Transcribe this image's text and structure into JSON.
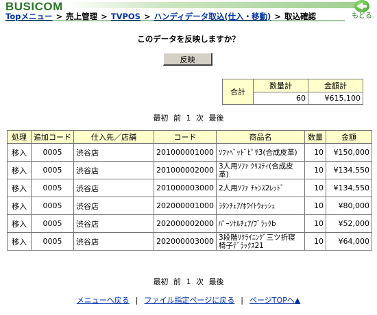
{
  "app": {
    "logo": "BUSICOM",
    "back_label": "もどる"
  },
  "breadcrumb": {
    "items": [
      "Topメニュー",
      "売上管理",
      "TVPOS",
      "ハンディデータ取込(仕入・移動)"
    ],
    "separator": ">",
    "current": "取込確認"
  },
  "question": "このデータを反映しますか？",
  "reflect_button": "反映",
  "summary": {
    "label": "合計",
    "qty_header": "数量計",
    "amount_header": "金額計",
    "qty": "60",
    "amount": "¥615,100"
  },
  "pager": {
    "first": "最初",
    "prev": "前",
    "page": "1",
    "next": "次",
    "last": "最後"
  },
  "table": {
    "headers": [
      "処理",
      "追加コード",
      "仕入先／店舗",
      "コード",
      "商品名",
      "数量",
      "金額"
    ],
    "rows": [
      [
        "移入",
        "0005",
        "渋谷店",
        "201000001000",
        "ｿﾌｧﾍﾞｯﾄﾞﾋﾟｻ3(合成皮革)",
        "10",
        "¥150,000"
      ],
      [
        "移入",
        "0005",
        "渋谷店",
        "201000002000",
        "3人用ｿﾌｧ ｸﾘｽﾃｨ(合成皮革)",
        "10",
        "¥134,550"
      ],
      [
        "移入",
        "0005",
        "渋谷店",
        "201000003000",
        "2人用ｿﾌｧ ﾁｬﾝｽ2ﾚｯﾄﾞ",
        "10",
        "¥134,550"
      ],
      [
        "移入",
        "0005",
        "渋谷店",
        "202000001000",
        "ﾗﾀﾝﾁｪｱ/ﾎﾜｲﾄｳｫｯｼｭ",
        "10",
        "¥80,000"
      ],
      [
        "移入",
        "0005",
        "渋谷店",
        "202000002000",
        "ﾊﾟｰｿﾅﾙﾁｪｱ/ﾌﾞﾗｯｸb",
        "10",
        "¥52,000"
      ],
      [
        "移入",
        "0005",
        "渋谷店",
        "202000003000",
        "3段階ﾘｸﾗｲﾆﾝｸﾞ三ツ折寝椅子ﾃﾞﾗｯｸｽ21",
        "10",
        "¥64,000"
      ]
    ]
  },
  "footer": {
    "links": [
      "メニューへ戻る",
      "ファイル指定ページに戻る",
      "ページTOPへ▲"
    ],
    "separator": "|"
  },
  "colors": {
    "brand": "#2a7a2a",
    "link": "#0033aa",
    "header_bg": "#ffffcc",
    "button_bg": "#d4d0c8"
  }
}
